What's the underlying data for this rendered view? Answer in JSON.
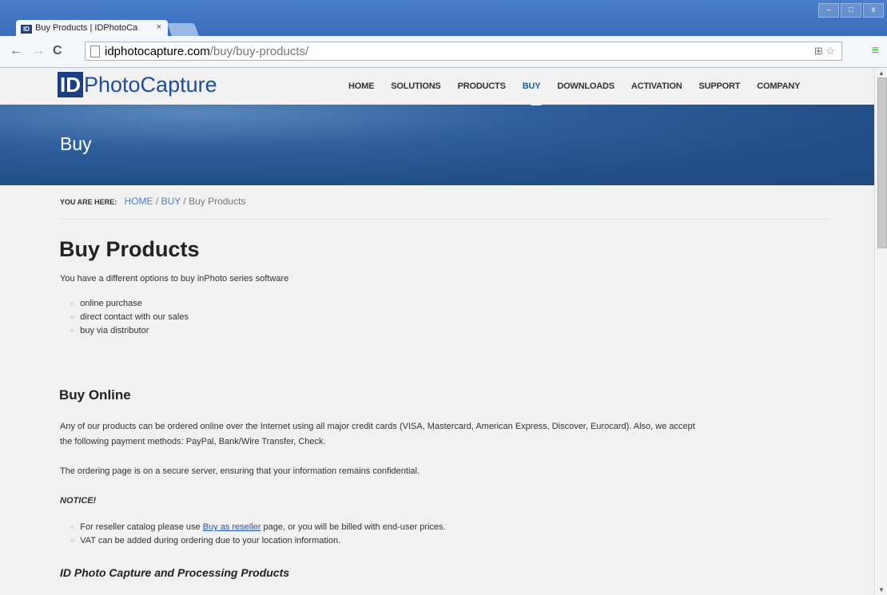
{
  "browser": {
    "tab_title": "Buy Products | IDPhotoCa",
    "favicon_text": "ID",
    "tab_close": "×",
    "url_host": "idphotocapture.com",
    "url_path": "/buy/buy-products/",
    "window_controls": [
      "–",
      "□",
      "x"
    ],
    "nav_back": "←",
    "nav_forward": "→",
    "nav_reload": "C",
    "omni_icons": "⊞ ☆",
    "menu_icon": "≡"
  },
  "site": {
    "logo_id": "ID",
    "logo_text": "PhotoCapture",
    "nav": [
      "HOME",
      "SOLUTIONS",
      "PRODUCTS",
      "BUY",
      "DOWNLOADS",
      "ACTIVATION",
      "SUPPORT",
      "COMPANY"
    ],
    "active_nav": "BUY",
    "banner_title": "Buy"
  },
  "breadcrumb": {
    "label": "YOU ARE HERE:",
    "items": [
      "HOME",
      "BUY",
      "Buy Products"
    ],
    "separator": "/"
  },
  "content": {
    "title": "Buy Products",
    "intro": "You have a different options to buy inPhoto series software",
    "options": [
      "online purchase",
      "direct contact with our sales",
      "buy via distributor"
    ],
    "buy_online_heading": "Buy Online",
    "buy_online_p1_line1": "Any of our products can be ordered online over the Internet using all major credit cards (VISA, Mastercard, American Express, Discover, Eurocard). Also, we accept",
    "buy_online_p1_line2": "the following payment methods: PayPal, Bank/Wire Transfer, Check.",
    "buy_online_p2": "The ordering page is on a secure server, ensuring that your information remains confidential.",
    "notice_label": "NOTICE!",
    "notice_1_before": "For reseller catalog please use ",
    "notice_1_link": "Buy as reseller",
    "notice_1_after": " page, or you will be billed with end-user prices.",
    "notice_2": "VAT can be added during ordering due to your location information.",
    "products_heading": "ID Photo Capture and Processing Products"
  },
  "colors": {
    "brand": "#1c3e84",
    "banner": "#2a5a97",
    "link": "#4b7fd1",
    "nav_active": "#2260a8"
  }
}
